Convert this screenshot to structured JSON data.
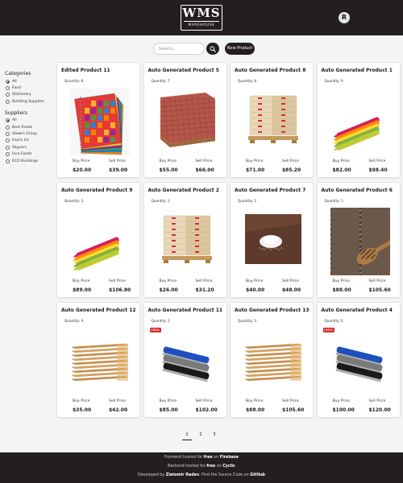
{
  "header": {
    "logo_main": "WMS",
    "logo_sub": "WAREHOUSE",
    "user_initial": "R"
  },
  "search": {
    "placeholder": "Search..",
    "new_product_label": "New Product"
  },
  "filters": {
    "categories_heading": "Categories",
    "categories": [
      "All",
      "Food",
      "Stationery",
      "Building Supplies"
    ],
    "categories_selected": "All",
    "suppliers_heading": "Suppliers",
    "suppliers": [
      "All",
      "Best Foods",
      "Stewm Group",
      "Expro Inc",
      "Skypers",
      "Inco Foods",
      "ECO Buildings"
    ],
    "suppliers_selected": "All"
  },
  "product_labels": {
    "buy_price": "Buy Price",
    "sell_price": "Sell Price"
  },
  "products": [
    {
      "name": "Edited Product 11",
      "quantity": "Quantity: 8",
      "buy": "$20.00",
      "sell": "$39.00",
      "image": "notebooks"
    },
    {
      "name": "Auto Generated Product 5",
      "quantity": "Quantity: 7",
      "buy": "$55.00",
      "sell": "$66.00",
      "image": "bricks"
    },
    {
      "name": "Auto Generated Product 8",
      "quantity": "Quantity: 8",
      "buy": "$71.00",
      "sell": "$85.20",
      "image": "cement-bags"
    },
    {
      "name": "Auto Generated Product 1",
      "quantity": "Quantity: 9",
      "buy": "$82.00",
      "sell": "$98.40",
      "image": "highlighters"
    },
    {
      "name": "Auto Generated Product 9",
      "quantity": "Quantity: 3",
      "buy": "$89.00",
      "sell": "$106.80",
      "image": "highlighters"
    },
    {
      "name": "Auto Generated Product 2",
      "quantity": "Quantity: 3",
      "buy": "$26.00",
      "sell": "$31.20",
      "image": "cement-bags"
    },
    {
      "name": "Auto Generated Product 7",
      "quantity": "Quantity: 2",
      "buy": "$40.00",
      "sell": "$48.00",
      "image": "salt"
    },
    {
      "name": "Auto Generated Product 6",
      "quantity": "Quantity: 3",
      "buy": "$88.00",
      "sell": "$105.60",
      "image": "chia-seeds"
    },
    {
      "name": "Auto Generated Product 12",
      "quantity": "Quantity: 9",
      "buy": "$35.00",
      "sell": "$42.00",
      "image": "lumber"
    },
    {
      "name": "Auto Generated Product 11",
      "quantity": "Quantity: 2",
      "buy": "$85.00",
      "sell": "$102.00",
      "image": "stapler",
      "badge": "GIMDA"
    },
    {
      "name": "Auto Generated Product 13",
      "quantity": "Quantity: 3",
      "buy": "$88.00",
      "sell": "$105.60",
      "image": "lumber"
    },
    {
      "name": "Auto Generated Product 4",
      "quantity": "Quantity: 6",
      "buy": "$100.00",
      "sell": "$120.00",
      "image": "stapler",
      "badge": "GIMDA"
    }
  ],
  "pagination": {
    "pages": [
      "1",
      "2",
      "3"
    ],
    "current": "1"
  },
  "footer": {
    "line1_pre": "Frontend hosted for",
    "line1_free": "free",
    "line1_on": "on",
    "line1_host": "Firebase",
    "line2_pre": "Backend hosted for",
    "line2_free": "free",
    "line2_on": "on",
    "line2_host": "Cyclic",
    "line3_pre": "Developed by",
    "line3_author": "Zlatomir Radev",
    "line3_mid": ". Find the Source Code on",
    "line3_host": "GitHub"
  },
  "colors": {
    "header_bg": "#231f20",
    "badge": "#d32f2f"
  }
}
